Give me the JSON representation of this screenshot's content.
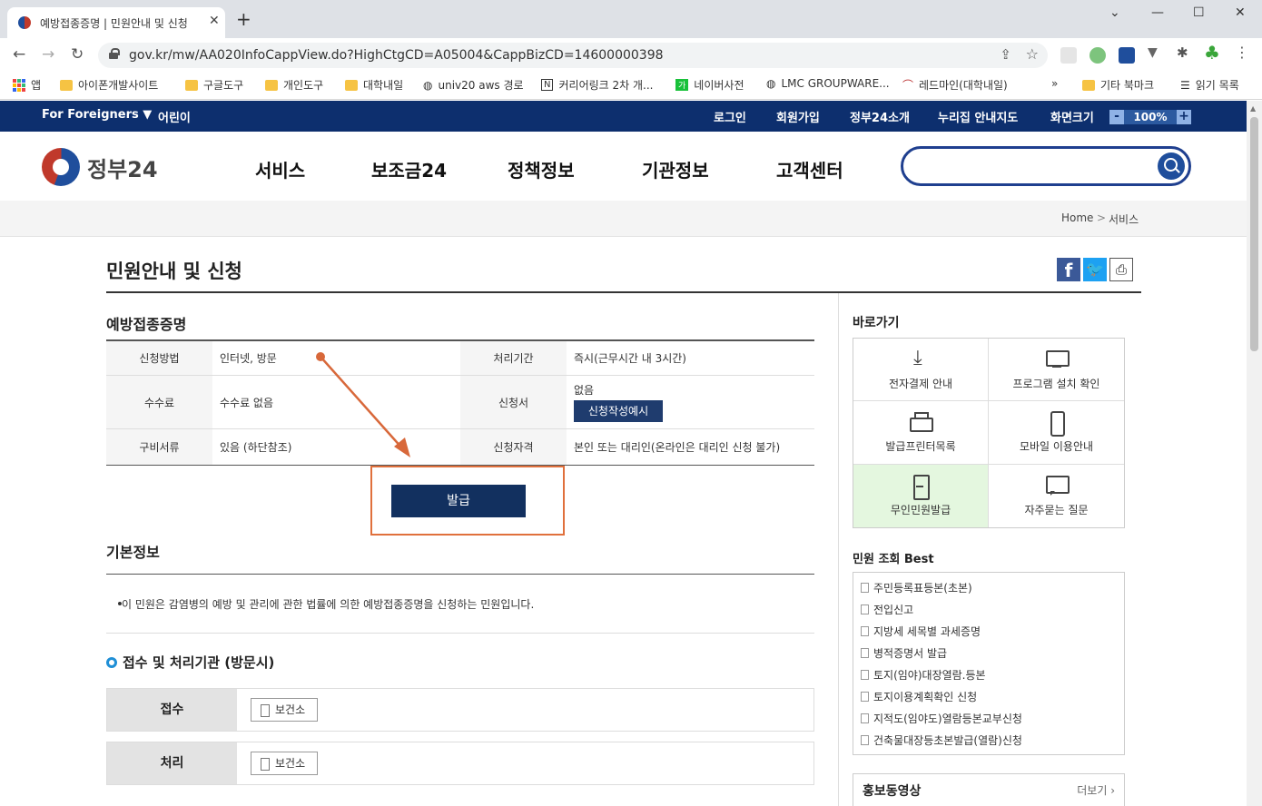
{
  "browser": {
    "tab_title": "예방접종증명 | 민원안내 및 신청",
    "url": "gov.kr/mw/AA020InfoCappView.do?HighCtgCD=A05004&CappBizCD=14600000398",
    "bookmarks": [
      "앱",
      "아이폰개발사이트",
      "구글도구",
      "개인도구",
      "대학내일",
      "univ20 aws 경로",
      "커리어링크 2차 개...",
      "네이버사전",
      "LMC GROUPWARE...",
      "레드마인(대학내일)",
      "»",
      "기타 북마크",
      "읽기 목록"
    ]
  },
  "utilbar": {
    "foreigners": "For Foreigners ▼",
    "kids": "어린이",
    "login": "로그인",
    "signup": "회원가입",
    "about": "정부24소개",
    "sitemap": "누리집 안내지도",
    "screen": "화면크기",
    "zoom_minus": "-",
    "zoom_value": "100%",
    "zoom_plus": "+"
  },
  "header": {
    "logo_text": "정부24",
    "nav": [
      "서비스",
      "보조금24",
      "정책정보",
      "기관정보",
      "고객센터"
    ]
  },
  "breadcrumb": {
    "home": "Home",
    "sep": ">",
    "current": "서비스"
  },
  "page": {
    "title": "민원안내 및 신청",
    "section_title": "예방접종증명",
    "info": {
      "method_label": "신청방법",
      "method_value": "인터넷, 방문",
      "period_label": "처리기간",
      "period_value": "즉시(근무시간 내 3시간)",
      "fee_label": "수수료",
      "fee_value": "수수료 없음",
      "form_label": "신청서",
      "form_value": "없음",
      "form_button": "신청작성예시",
      "docs_label": "구비서류",
      "docs_value": "있음 (하단참조)",
      "qual_label": "신청자격",
      "qual_value": "본인 또는 대리인(온라인은 대리인 신청 불가)"
    },
    "issue_button": "발급",
    "basic_title": "기본정보",
    "basic_text": "이 민원은 감염병의 예방 및 관리에 관한 법률에 의한 예방접종증명을 신청하는 민원입니다.",
    "receive_title": "접수 및 처리기관 (방문시)",
    "receive_rows": [
      {
        "label": "접수",
        "tag": "보건소"
      },
      {
        "label": "처리",
        "tag": "보건소"
      }
    ]
  },
  "sidebar": {
    "quick_title": "바로가기",
    "quick": [
      {
        "icon": "download-icon",
        "label": "전자결제 안내"
      },
      {
        "icon": "monitor-icon",
        "label": "프로그램 설치 확인"
      },
      {
        "icon": "printer-icon",
        "label": "발급프린터목록"
      },
      {
        "icon": "mobile-icon",
        "label": "모바일 이용안내"
      },
      {
        "icon": "kiosk-icon",
        "label": "무인민원발급"
      },
      {
        "icon": "faq-icon",
        "label": "자주묻는 질문"
      }
    ],
    "best_title": "민원 조회 Best",
    "best": [
      "주민등록표등본(초본)",
      "전입신고",
      "지방세 세목별 과세증명",
      "병적증명서 발급",
      "토지(임야)대장열람.등본",
      "토지이용계획확인 신청",
      "지적도(임야도)열람등본교부신청",
      "건축물대장등초본발급(열람)신청"
    ],
    "video_title": "홍보동영상",
    "video_more": "더보기 ›"
  },
  "colors": {
    "accent_navy": "#0d2f6e",
    "highlight_orange": "#e0703c",
    "kiosk_green": "#e4f7df"
  }
}
